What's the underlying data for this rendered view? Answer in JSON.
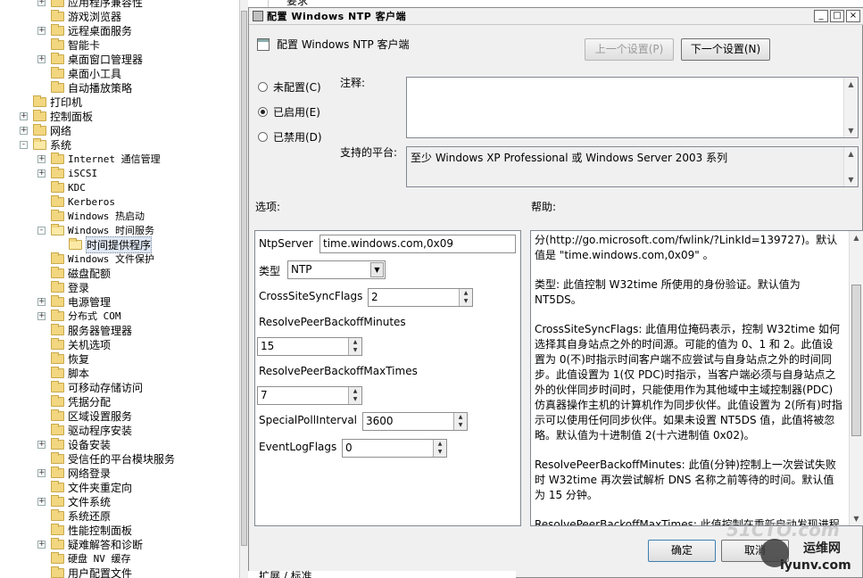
{
  "tree": {
    "items": [
      {
        "label": "应用程序兼容性",
        "indent": 2,
        "expander": "+"
      },
      {
        "label": "游戏浏览器",
        "indent": 2,
        "expander": ""
      },
      {
        "label": "远程桌面服务",
        "indent": 2,
        "expander": "+"
      },
      {
        "label": "智能卡",
        "indent": 2,
        "expander": ""
      },
      {
        "label": "桌面窗口管理器",
        "indent": 2,
        "expander": "+"
      },
      {
        "label": "桌面小工具",
        "indent": 2,
        "expander": ""
      },
      {
        "label": "自动播放策略",
        "indent": 2,
        "expander": ""
      },
      {
        "label": "打印机",
        "indent": 1,
        "expander": ""
      },
      {
        "label": "控制面板",
        "indent": 1,
        "expander": "+"
      },
      {
        "label": "网络",
        "indent": 1,
        "expander": "+"
      },
      {
        "label": "系统",
        "indent": 1,
        "expander": "-"
      },
      {
        "label": "Internet 通信管理",
        "indent": 2,
        "expander": "+",
        "mono": true
      },
      {
        "label": "iSCSI",
        "indent": 2,
        "expander": "+",
        "mono": true
      },
      {
        "label": "KDC",
        "indent": 2,
        "expander": "",
        "mono": true
      },
      {
        "label": "Kerberos",
        "indent": 2,
        "expander": "",
        "mono": true
      },
      {
        "label": "Windows 热启动",
        "indent": 2,
        "expander": "",
        "mono": true
      },
      {
        "label": "Windows 时间服务",
        "indent": 2,
        "expander": "-",
        "mono": true
      },
      {
        "label": "时间提供程序",
        "indent": 3,
        "expander": "",
        "selected": true
      },
      {
        "label": "Windows 文件保护",
        "indent": 2,
        "expander": "",
        "mono": true
      },
      {
        "label": "磁盘配额",
        "indent": 2,
        "expander": ""
      },
      {
        "label": "登录",
        "indent": 2,
        "expander": ""
      },
      {
        "label": "电源管理",
        "indent": 2,
        "expander": "+"
      },
      {
        "label": "分布式 COM",
        "indent": 2,
        "expander": "+",
        "mono": true
      },
      {
        "label": "服务器管理器",
        "indent": 2,
        "expander": ""
      },
      {
        "label": "关机选项",
        "indent": 2,
        "expander": ""
      },
      {
        "label": "恢复",
        "indent": 2,
        "expander": ""
      },
      {
        "label": "脚本",
        "indent": 2,
        "expander": ""
      },
      {
        "label": "可移动存储访问",
        "indent": 2,
        "expander": ""
      },
      {
        "label": "凭据分配",
        "indent": 2,
        "expander": ""
      },
      {
        "label": "区域设置服务",
        "indent": 2,
        "expander": ""
      },
      {
        "label": "驱动程序安装",
        "indent": 2,
        "expander": ""
      },
      {
        "label": "设备安装",
        "indent": 2,
        "expander": "+"
      },
      {
        "label": "受信任的平台模块服务",
        "indent": 2,
        "expander": ""
      },
      {
        "label": "网络登录",
        "indent": 2,
        "expander": "+"
      },
      {
        "label": "文件夹重定向",
        "indent": 2,
        "expander": ""
      },
      {
        "label": "文件系统",
        "indent": 2,
        "expander": "+"
      },
      {
        "label": "系统还原",
        "indent": 2,
        "expander": ""
      },
      {
        "label": "性能控制面板",
        "indent": 2,
        "expander": ""
      },
      {
        "label": "疑难解答和诊断",
        "indent": 2,
        "expander": "+"
      },
      {
        "label": "硬盘 NV 缓存",
        "indent": 2,
        "expander": "",
        "mono": true
      },
      {
        "label": "用户配置文件",
        "indent": 2,
        "expander": ""
      }
    ]
  },
  "background": {
    "top_text": "要求",
    "bottom_text": "扩展 / 标准"
  },
  "dialog": {
    "title": "配置 Windows NTP 客户端",
    "header_label": "配置 Windows NTP 客户端",
    "prev_button": "上一个设置(P)",
    "next_button": "下一个设置(N)",
    "minimize": "_",
    "maximize": "□",
    "close": "×",
    "radios": [
      {
        "label": "未配置(C)",
        "checked": false
      },
      {
        "label": "已启用(E)",
        "checked": true
      },
      {
        "label": "已禁用(D)",
        "checked": false
      }
    ],
    "comment_label": "注释:",
    "comment_value": "",
    "platform_label": "支持的平台:",
    "platform_value": "至少 Windows XP Professional 或 Windows Server 2003 系列",
    "options_label": "选项:",
    "help_label": "帮助:",
    "options": {
      "ntpserver_label": "NtpServer",
      "ntpserver_value": "time.windows.com,0x09",
      "type_label": "类型",
      "type_value": "NTP",
      "crosssite_label": "CrossSiteSyncFlags",
      "crosssite_value": "2",
      "backoffmin_label": "ResolvePeerBackoffMinutes",
      "backoffmin_value": "15",
      "backoffmax_label": "ResolvePeerBackoffMaxTimes",
      "backoffmax_value": "7",
      "specialpoll_label": "SpecialPollInterval",
      "specialpoll_value": "3600",
      "eventlog_label": "EventLogFlags",
      "eventlog_value": "0"
    },
    "help_paragraphs": [
      "分(http://go.microsoft.com/fwlink/?LinkId=139727)。默认值是 \"time.windows.com,0x09\" 。",
      "类型: 此值控制 W32time 所使用的身份验证。默认值为 NT5DS。",
      "CrossSiteSyncFlags: 此值用位掩码表示，控制 W32time 如何选择其自身站点之外的时间源。可能的值为 0、1 和 2。此值设置为 0(不)时指示时间客户端不应尝试与自身站点之外的时间同步。此值设置为 1(仅 PDC)时指示，当客户端必须与自身站点之外的伙伴同步时间时，只能使用作为其他域中主域控制器(PDC)仿真器操作主机的计算机作为同步伙伴。此值设置为 2(所有)时指示可以使用任何同步伙伴。如果未设置 NT5DS 值，此值将被忽略。默认值为十进制值 2(十六进制值 0x02)。",
      "ResolvePeerBackoffMinutes: 此值(分钟)控制上一次尝试失败时 W32time 再次尝试解析 DNS 名称之前等待的时间。默认值为 15 分钟。",
      "ResolvePeerBackoffMaxTimes: 此值控制在重新启动发现进程之"
    ],
    "ok_button": "确定",
    "cancel_button": "取消"
  },
  "watermark": {
    "text1": "51CTO.com",
    "text2": "运维网",
    "text3": "iyunv.com"
  }
}
